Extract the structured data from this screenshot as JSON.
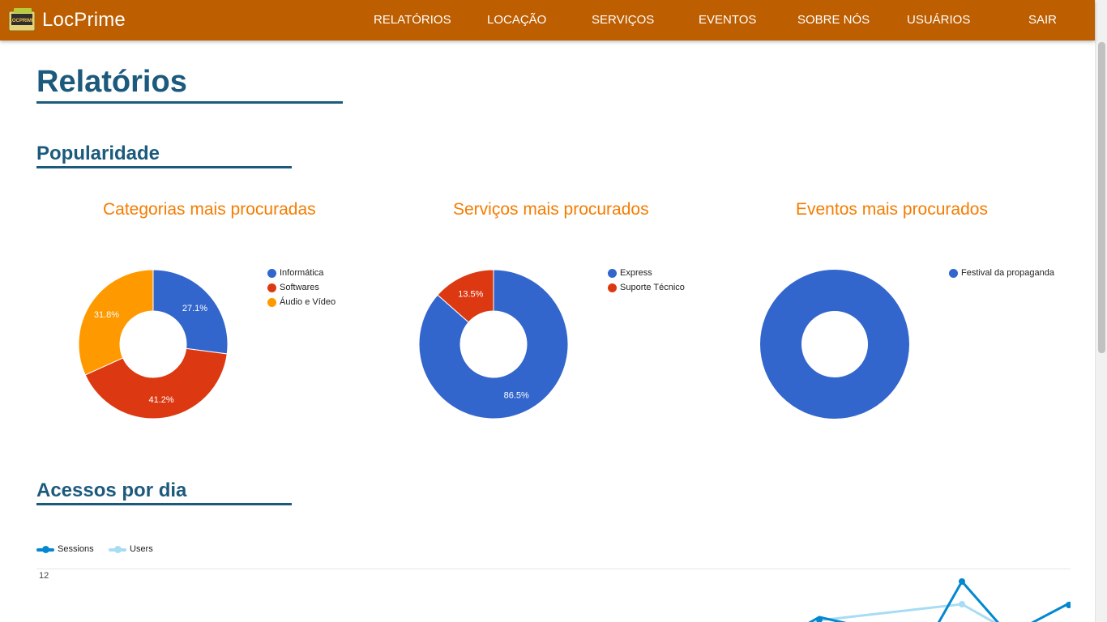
{
  "app": {
    "brand": "LocPrime",
    "logo_text": "LOCPRIME",
    "brand_color": "#bd5e00"
  },
  "nav": {
    "items": [
      {
        "label": "RELATÓRIOS"
      },
      {
        "label": "LOCAÇÃO"
      },
      {
        "label": "SERVIÇOS"
      },
      {
        "label": "EVENTOS"
      },
      {
        "label": "SOBRE NÓS"
      },
      {
        "label": "USUÁRIOS"
      },
      {
        "label": "SAIR"
      }
    ]
  },
  "page": {
    "title": "Relatórios",
    "section_popularity": "Popularidade",
    "section_access": "Acessos por dia"
  },
  "chart_data": [
    {
      "type": "pie",
      "title": "Categorias mais procuradas",
      "categories": [
        "Informática",
        "Softwares",
        "Áudio e Vídeo"
      ],
      "values": [
        27.1,
        41.2,
        31.8
      ],
      "labels": [
        "27.1%",
        "41.2%",
        "31.8%"
      ],
      "colors": [
        "#3366cc",
        "#dc3912",
        "#ff9900"
      ],
      "legend": "right"
    },
    {
      "type": "pie",
      "title": "Serviços mais procurados",
      "categories": [
        "Express",
        "Suporte Técnico"
      ],
      "values": [
        86.5,
        13.5
      ],
      "labels": [
        "86.5%",
        "13.5%"
      ],
      "colors": [
        "#3366cc",
        "#dc3912"
      ],
      "legend": "right"
    },
    {
      "type": "pie",
      "title": "Eventos mais procurados",
      "categories": [
        "Festival da propaganda"
      ],
      "values": [
        100
      ],
      "labels": [
        ""
      ],
      "colors": [
        "#3366cc"
      ],
      "legend": "right"
    },
    {
      "type": "line",
      "series": [
        {
          "name": "Sessions",
          "color": "#0288d1"
        },
        {
          "name": "Users",
          "color": "#a8dcf4"
        }
      ],
      "y_ticks": [
        "12"
      ],
      "legend": "top-left"
    }
  ]
}
